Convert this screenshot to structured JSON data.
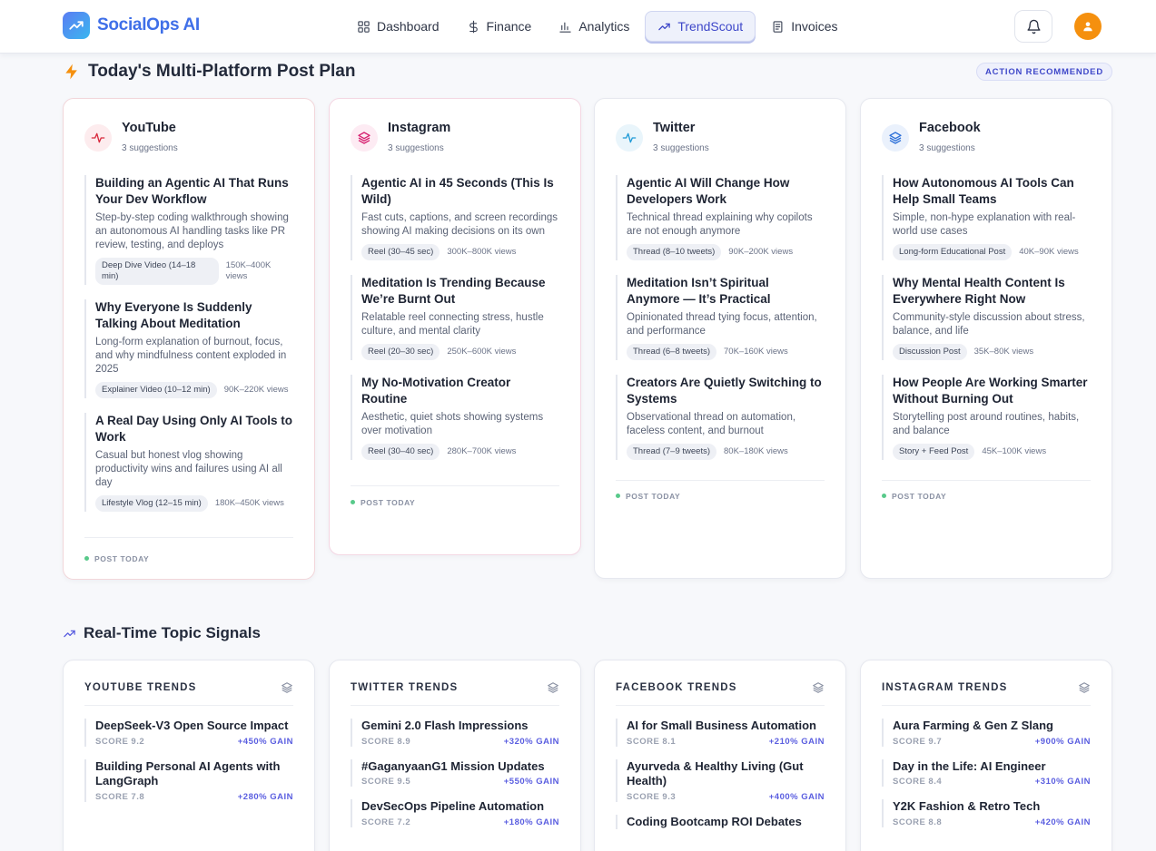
{
  "app": {
    "name": "SocialOps AI"
  },
  "nav": [
    {
      "label": "Dashboard",
      "icon": "grid-icon",
      "active": false
    },
    {
      "label": "Finance",
      "icon": "dollar-icon",
      "active": false
    },
    {
      "label": "Analytics",
      "icon": "bar-chart-icon",
      "active": false
    },
    {
      "label": "TrendScout",
      "icon": "trend-icon",
      "active": true
    },
    {
      "label": "Invoices",
      "icon": "document-icon",
      "active": false
    }
  ],
  "plan": {
    "title": "Today's Multi-Platform Post Plan",
    "badge": "ACTION RECOMMENDED",
    "platforms": [
      {
        "name": "YouTube",
        "count": "3 suggestions",
        "footer": "POST TODAY",
        "suggestions": [
          {
            "title": "Building an Agentic AI That Runs Your Dev Workflow",
            "desc": "Step-by-step coding walkthrough showing an autonomous AI handling tasks like PR review, testing, and deploys",
            "format": "Deep Dive Video (14–18 min)",
            "views": "150K–400K views"
          },
          {
            "title": "Why Everyone Is Suddenly Talking About Meditation",
            "desc": "Long-form explanation of burnout, focus, and why mindfulness content exploded in 2025",
            "format": "Explainer Video (10–12 min)",
            "views": "90K–220K views"
          },
          {
            "title": "A Real Day Using Only AI Tools to Work",
            "desc": "Casual but honest vlog showing productivity wins and failures using AI all day",
            "format": "Lifestyle Vlog (12–15 min)",
            "views": "180K–450K views"
          }
        ]
      },
      {
        "name": "Instagram",
        "count": "3 suggestions",
        "footer": "POST TODAY",
        "suggestions": [
          {
            "title": "Agentic AI in 45 Seconds (This Is Wild)",
            "desc": "Fast cuts, captions, and screen recordings showing AI making decisions on its own",
            "format": "Reel (30–45 sec)",
            "views": "300K–800K views"
          },
          {
            "title": "Meditation Is Trending Because We’re Burnt Out",
            "desc": "Relatable reel connecting stress, hustle culture, and mental clarity",
            "format": "Reel (20–30 sec)",
            "views": "250K–600K views"
          },
          {
            "title": "My No-Motivation Creator Routine",
            "desc": "Aesthetic, quiet shots showing systems over motivation",
            "format": "Reel (30–40 sec)",
            "views": "280K–700K views"
          }
        ]
      },
      {
        "name": "Twitter",
        "count": "3 suggestions",
        "footer": "POST TODAY",
        "suggestions": [
          {
            "title": "Agentic AI Will Change How Developers Work",
            "desc": "Technical thread explaining why copilots are not enough anymore",
            "format": "Thread (8–10 tweets)",
            "views": "90K–200K views"
          },
          {
            "title": "Meditation Isn’t Spiritual Anymore — It’s Practical",
            "desc": "Opinionated thread tying focus, attention, and performance",
            "format": "Thread (6–8 tweets)",
            "views": "70K–160K views"
          },
          {
            "title": "Creators Are Quietly Switching to Systems",
            "desc": "Observational thread on automation, faceless content, and burnout",
            "format": "Thread (7–9 tweets)",
            "views": "80K–180K views"
          }
        ]
      },
      {
        "name": "Facebook",
        "count": "3 suggestions",
        "footer": "POST TODAY",
        "suggestions": [
          {
            "title": "How Autonomous AI Tools Can Help Small Teams",
            "desc": "Simple, non-hype explanation with real-world use cases",
            "format": "Long-form Educational Post",
            "views": "40K–90K views"
          },
          {
            "title": "Why Mental Health Content Is Everywhere Right Now",
            "desc": "Community-style discussion about stress, balance, and life",
            "format": "Discussion Post",
            "views": "35K–80K views"
          },
          {
            "title": "How People Are Working Smarter Without Burning Out",
            "desc": "Storytelling post around routines, habits, and balance",
            "format": "Story + Feed Post",
            "views": "45K–100K views"
          }
        ]
      }
    ]
  },
  "signals": {
    "title": "Real-Time Topic Signals",
    "cards": [
      {
        "title": "YOUTUBE TRENDS",
        "items": [
          {
            "topic": "DeepSeek-V3 Open Source Impact",
            "score": "SCORE 9.2",
            "gain": "+450% GAIN"
          },
          {
            "topic": "Building Personal AI Agents with LangGraph",
            "score": "SCORE 7.8",
            "gain": "+280% GAIN"
          }
        ]
      },
      {
        "title": "TWITTER TRENDS",
        "items": [
          {
            "topic": "Gemini 2.0 Flash Impressions",
            "score": "SCORE 8.9",
            "gain": "+320% GAIN"
          },
          {
            "topic": "#GaganyaanG1 Mission Updates",
            "score": "SCORE 9.5",
            "gain": "+550% GAIN"
          },
          {
            "topic": "DevSecOps Pipeline Automation",
            "score": "SCORE 7.2",
            "gain": "+180% GAIN"
          }
        ]
      },
      {
        "title": "FACEBOOK TRENDS",
        "items": [
          {
            "topic": "AI for Small Business Automation",
            "score": "SCORE 8.1",
            "gain": "+210% GAIN"
          },
          {
            "topic": "Ayurveda & Healthy Living (Gut Health)",
            "score": "SCORE 9.3",
            "gain": "+400% GAIN"
          },
          {
            "topic": "Coding Bootcamp ROI Debates",
            "score": "",
            "gain": ""
          }
        ]
      },
      {
        "title": "INSTAGRAM TRENDS",
        "items": [
          {
            "topic": "Aura Farming & Gen Z Slang",
            "score": "SCORE 9.7",
            "gain": "+900% GAIN"
          },
          {
            "topic": "Day in the Life: AI Engineer",
            "score": "SCORE 8.4",
            "gain": "+310% GAIN"
          },
          {
            "topic": "Y2K Fashion & Retro Tech",
            "score": "SCORE 8.8",
            "gain": "+420% GAIN"
          }
        ]
      }
    ]
  }
}
